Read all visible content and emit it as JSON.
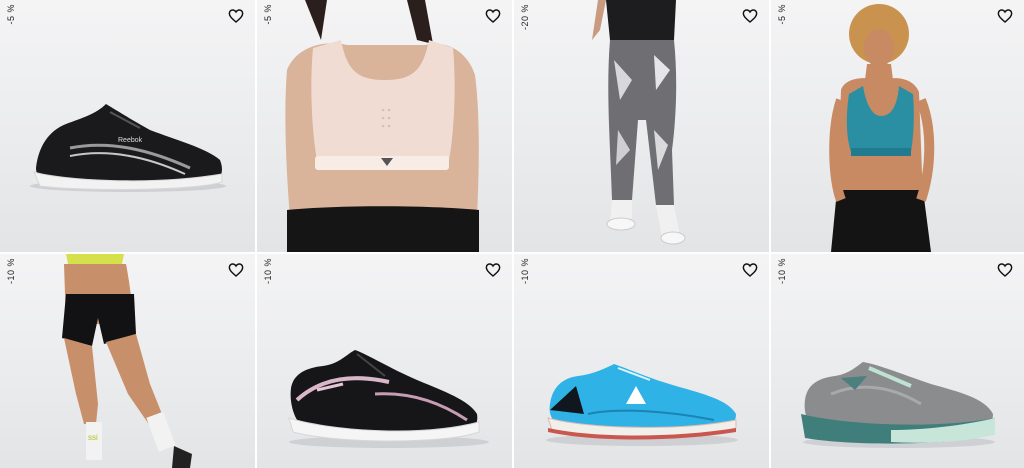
{
  "products": [
    {
      "discount": "-5 %",
      "image": "black-running-shoe"
    },
    {
      "discount": "-5 %",
      "image": "pink-sports-bra"
    },
    {
      "discount": "-20 %",
      "image": "printed-leggings"
    },
    {
      "discount": "-5 %",
      "image": "teal-sports-bra"
    },
    {
      "discount": "-10 %",
      "image": "black-training-shorts"
    },
    {
      "discount": "-10 %",
      "image": "black-pink-running-shoe"
    },
    {
      "discount": "-10 %",
      "image": "cyan-running-shoe"
    },
    {
      "discount": "-10 %",
      "image": "grey-teal-training-shoe"
    }
  ],
  "icons": {
    "wishlist": "heart-outline-icon"
  },
  "colors": {
    "tile_background": "#ebecee",
    "text": "#222222",
    "heart_stroke": "#111111"
  }
}
